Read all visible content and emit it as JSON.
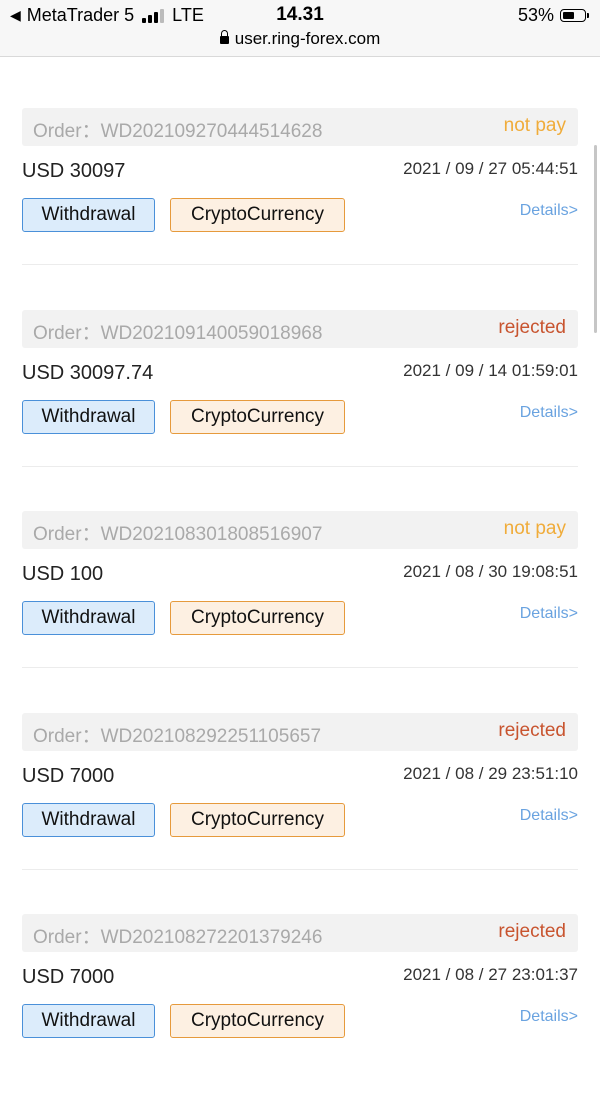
{
  "status_bar": {
    "back_app": "MetaTrader 5",
    "network": "LTE",
    "time": "14.31",
    "url": "user.ring-forex.com",
    "battery": "53%"
  },
  "colors": {
    "not_pay": "#f0ac3a",
    "rejected": "#c8542f"
  },
  "orders": [
    {
      "label": "Order：WD20210927044451462​8",
      "status": "not pay",
      "status_kind": "not_pay",
      "amount": "USD 30097",
      "date": "2021 / 09 / 27 05:44:51",
      "type": "Withdrawal",
      "method": "CryptoCurrency",
      "details": "Details>"
    },
    {
      "label": "Order：WD202109140059018968",
      "status": "rejected",
      "status_kind": "rejected",
      "amount": "USD 30097.74",
      "date": "2021 / 09 / 14 01:59:01",
      "type": "Withdrawal",
      "method": "CryptoCurrency",
      "details": "Details>"
    },
    {
      "label": "Order：WD202108301808516907",
      "status": "not pay",
      "status_kind": "not_pay",
      "amount": "USD 100",
      "date": "2021 / 08 / 30 19:08:51",
      "type": "Withdrawal",
      "method": "CryptoCurrency",
      "details": "Details>"
    },
    {
      "label": "Order：WD202108292251105657",
      "status": "rejected",
      "status_kind": "rejected",
      "amount": "USD 7000",
      "date": "2021 / 08 / 29 23:51:10",
      "type": "Withdrawal",
      "method": "CryptoCurrency",
      "details": "Details>"
    },
    {
      "label": "Order：WD202108272201379246",
      "status": "rejected",
      "status_kind": "rejected",
      "amount": "USD 7000",
      "date": "2021 / 08 / 27 23:01:37",
      "type": "Withdrawal",
      "method": "CryptoCurrency",
      "details": "Details>"
    }
  ]
}
